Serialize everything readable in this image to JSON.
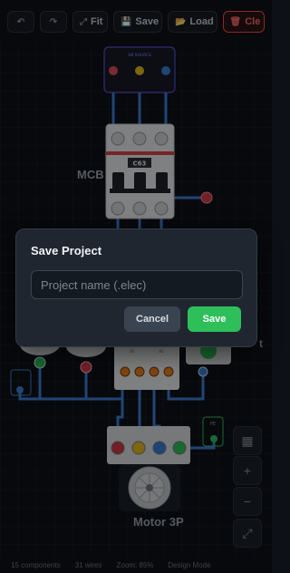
{
  "toolbar": {
    "undo_icon": "undo-icon",
    "redo_icon": "redo-icon",
    "fit_label": "Fit",
    "save_label": "Save",
    "load_label": "Load",
    "clear_label": "Cle"
  },
  "canvas": {
    "source_label": "3Ø SOURCE",
    "mcb_label": "MCB",
    "mcb_rating": "C63",
    "motor_label": "Motor 3P",
    "contactor_terminals": [
      "A1",
      "A2"
    ],
    "overload_label": "t",
    "pe_label": "PE"
  },
  "zoom": {
    "grid_icon": "grid-icon",
    "zoom_in": "+",
    "zoom_out": "−",
    "fit_icon": "expand-icon"
  },
  "status": {
    "components": "15 components",
    "wires": "31 wires",
    "zoom": "Zoom: 85%",
    "mode": "Design Mode"
  },
  "modal": {
    "title": "Save Project",
    "placeholder": "Project name (.elec)",
    "value": "",
    "cancel_label": "Cancel",
    "save_label": "Save"
  },
  "colors": {
    "accent_green": "#2fbf5a",
    "danger": "#f85149",
    "wire": "#3b7fd6"
  }
}
